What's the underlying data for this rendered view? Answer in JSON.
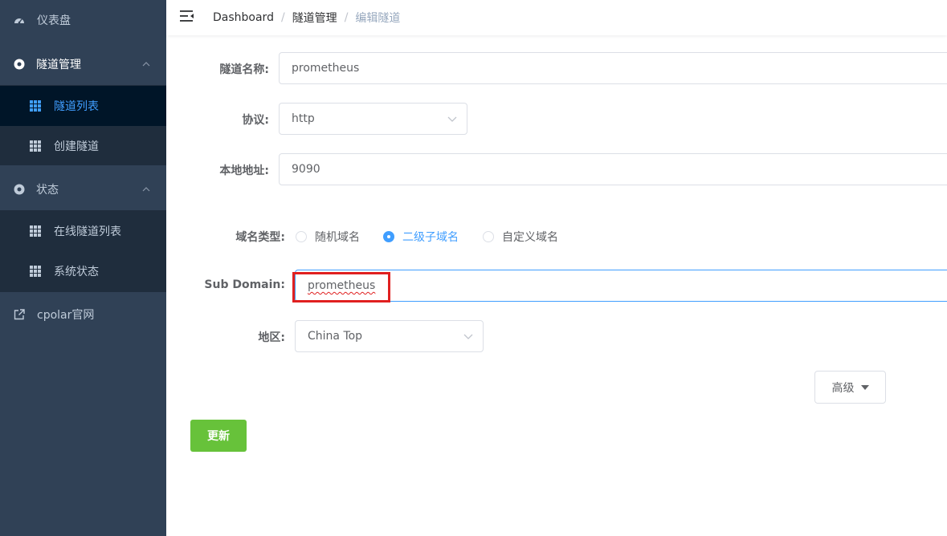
{
  "sidebar": {
    "dashboard": "仪表盘",
    "tunnel_manage": "隧道管理",
    "tunnel_list": "隧道列表",
    "create_tunnel": "创建隧道",
    "status": "状态",
    "online_tunnels": "在线隧道列表",
    "system_status": "系统状态",
    "website": "cpolar官网"
  },
  "breadcrumb": {
    "home": "Dashboard",
    "section": "隧道管理",
    "current": "编辑隧道",
    "separator": "/"
  },
  "form": {
    "name_label": "隧道名称:",
    "name_value": "prometheus",
    "protocol_label": "协议:",
    "protocol_value": "http",
    "local_label": "本地地址:",
    "local_value": "9090",
    "domain_type_label": "域名类型:",
    "domain_options": [
      "随机域名",
      "二级子域名",
      "自定义域名"
    ],
    "subdomain_label": "Sub Domain:",
    "subdomain_value": "prometheus",
    "region_label": "地区:",
    "region_value": "China Top",
    "advanced_label": "高级",
    "update_label": "更新"
  },
  "colors": {
    "sidebar_bg": "#304156",
    "submenu_bg": "#1f2d3d",
    "active_color": "#409eff",
    "update_btn": "#67c23a",
    "highlight": "#e02020"
  }
}
